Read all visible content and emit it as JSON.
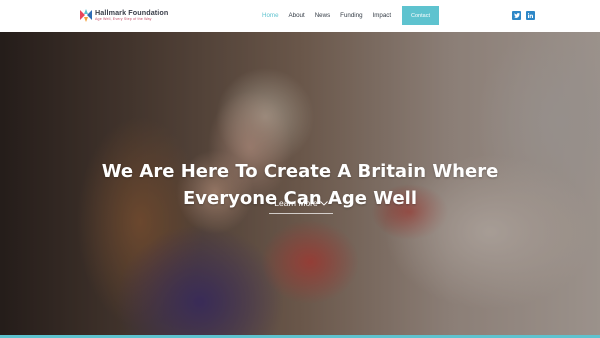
{
  "brand": {
    "name": "Hallmark Foundation",
    "tagline": "Age Well, Every Step of the Way",
    "mark_colors": [
      "#e9455a",
      "#5ec3cf",
      "#2e6cb5",
      "#f4a13a"
    ]
  },
  "nav": {
    "items": [
      {
        "label": "Home",
        "active": true
      },
      {
        "label": "About",
        "active": false
      },
      {
        "label": "News",
        "active": false
      },
      {
        "label": "Funding",
        "active": false
      },
      {
        "label": "Impact",
        "active": false
      }
    ],
    "contact_label": "Contact",
    "social": [
      {
        "icon": "twitter-icon"
      },
      {
        "icon": "linkedin-icon"
      }
    ]
  },
  "hero": {
    "title_line1": "We Are Here To Create A Britain Where",
    "title_line2": "Everyone Can Age Well",
    "cta_label": "Learn More"
  },
  "colors": {
    "accent": "#5ec3cf",
    "social": "#2e87c7",
    "text": "#333b45"
  }
}
